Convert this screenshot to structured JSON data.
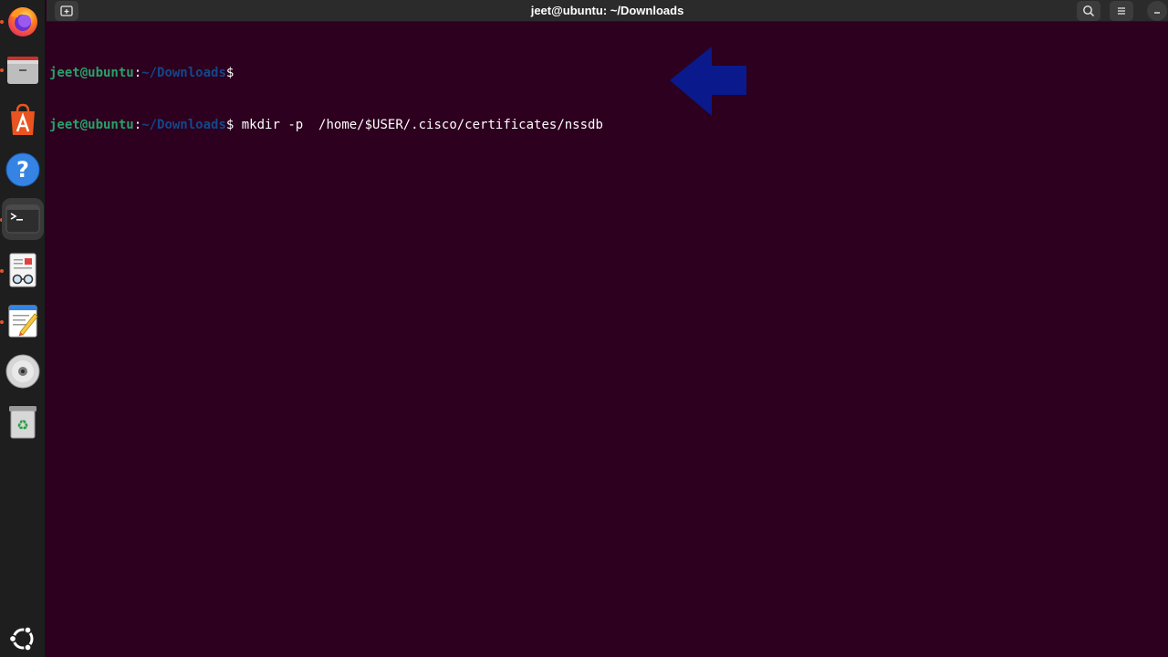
{
  "window": {
    "title": "jeet@ubuntu: ~/Downloads"
  },
  "dock": {
    "items": [
      {
        "name": "Firefox",
        "icon": "firefox-icon",
        "running": true
      },
      {
        "name": "Files",
        "icon": "files-icon",
        "running": true
      },
      {
        "name": "App Center",
        "icon": "app-center-icon",
        "running": false
      },
      {
        "name": "Help",
        "icon": "help-icon",
        "running": false
      },
      {
        "name": "Terminal",
        "icon": "terminal-icon",
        "running": true,
        "active": true
      },
      {
        "name": "Document Viewer",
        "icon": "document-viewer-icon",
        "running": true
      },
      {
        "name": "Text Editor",
        "icon": "text-editor-icon",
        "running": true
      },
      {
        "name": "Disc",
        "icon": "disc-icon",
        "running": false
      },
      {
        "name": "Trash",
        "icon": "trash-icon",
        "running": false
      }
    ],
    "show_apps_icon": "ubuntu-logo-icon"
  },
  "terminal": {
    "lines": [
      {
        "user": "jeet@ubuntu",
        "sep": ":",
        "path": "~/Downloads",
        "dollar": "$",
        "command": ""
      },
      {
        "user": "jeet@ubuntu",
        "sep": ":",
        "path": "~/Downloads",
        "dollar": "$",
        "command": " mkdir -p  /home/$USER/.cisco/certificates/nssdb"
      }
    ]
  },
  "annotation": {
    "icon": "left-arrow-icon",
    "color": "#0a1a8c"
  },
  "colors": {
    "terminal_bg": "#2c001e",
    "prompt_user": "#26a269",
    "prompt_path": "#12488b",
    "accent": "#e95420"
  }
}
